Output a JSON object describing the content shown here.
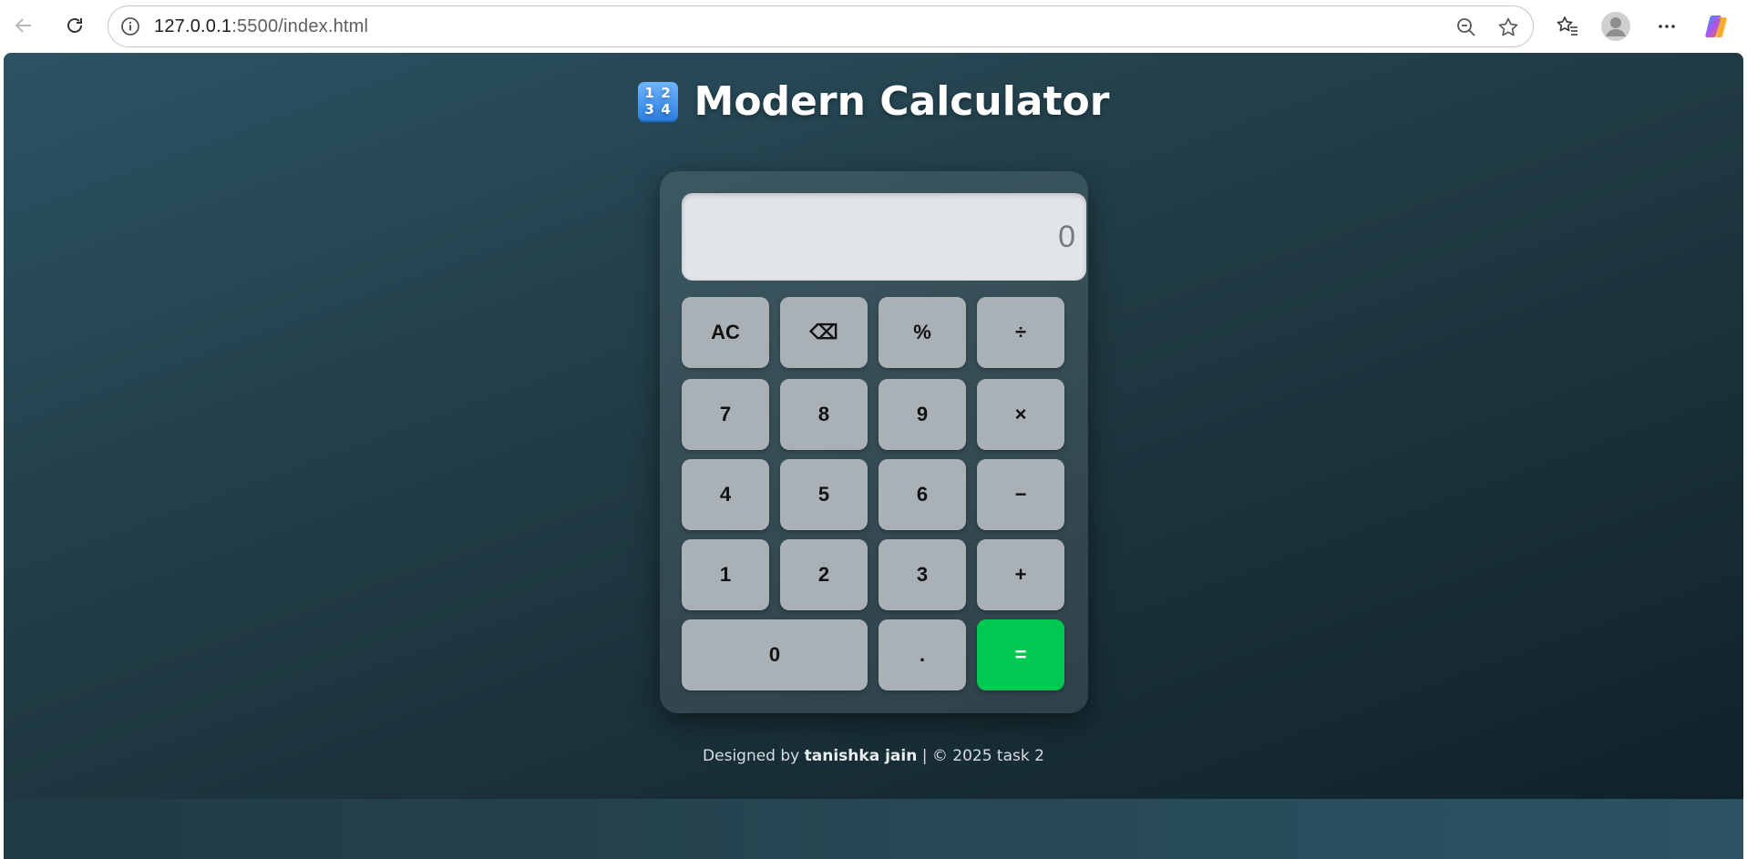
{
  "browser": {
    "url_host": "127.0.0.1",
    "url_path": ":5500/index.html"
  },
  "page": {
    "title_emoji_digits": [
      "1",
      "2",
      "3",
      "4"
    ],
    "title": "Modern Calculator"
  },
  "calculator": {
    "display_value": "0",
    "rows": [
      [
        {
          "label": "AC",
          "type": "clear"
        },
        {
          "label": "⌫",
          "type": "backspace"
        },
        {
          "label": "%",
          "type": "operator"
        },
        {
          "label": "÷",
          "type": "operator"
        }
      ],
      [
        {
          "label": "7",
          "type": "digit"
        },
        {
          "label": "8",
          "type": "digit"
        },
        {
          "label": "9",
          "type": "digit"
        },
        {
          "label": "×",
          "type": "operator"
        }
      ],
      [
        {
          "label": "4",
          "type": "digit"
        },
        {
          "label": "5",
          "type": "digit"
        },
        {
          "label": "6",
          "type": "digit"
        },
        {
          "label": "−",
          "type": "operator"
        }
      ],
      [
        {
          "label": "1",
          "type": "digit"
        },
        {
          "label": "2",
          "type": "digit"
        },
        {
          "label": "3",
          "type": "digit"
        },
        {
          "label": "+",
          "type": "operator"
        }
      ],
      [
        {
          "label": "0",
          "type": "digit"
        },
        {
          "label": ".",
          "type": "digit"
        },
        {
          "label": "=",
          "type": "equals"
        }
      ]
    ],
    "equals_color": "#00c853",
    "key_color": "#a9b1b6"
  },
  "footer": {
    "prefix": "Designed by",
    "author": "tanishka jain",
    "suffix": "| © 2025 task 2"
  }
}
